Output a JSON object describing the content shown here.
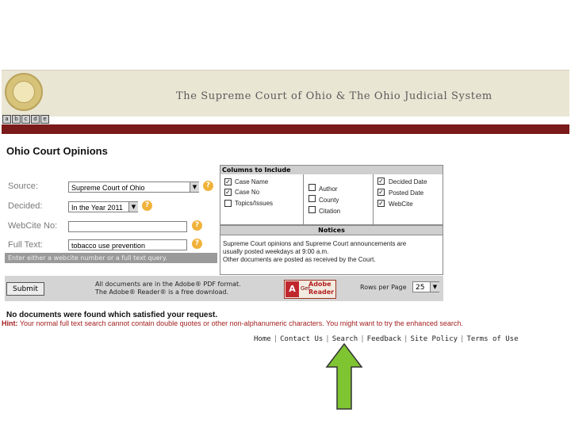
{
  "header": {
    "banner_title": "The Supreme Court of Ohio & The Ohio Judicial System",
    "icon_row": [
      "a",
      "b",
      "c",
      "d",
      "e"
    ]
  },
  "page_title": "Ohio Court Opinions",
  "form": {
    "source_label": "Source:",
    "source_value": "Supreme Court of Ohio",
    "decided_label": "Decided:",
    "decided_value": "In the Year 2011",
    "webcite_label": "WebCite No:",
    "webcite_value": "",
    "fulltext_label": "Full Text:",
    "fulltext_value": "tobacco use prevention",
    "hint_strip": "Enter either a webcite number or a full text query."
  },
  "columns": {
    "header": "Columns to Include",
    "items": [
      {
        "label": "Case Name",
        "checked": true
      },
      {
        "label": "Case No",
        "checked": true
      },
      {
        "label": "Topics/Issues",
        "checked": false
      },
      {
        "label": "Author",
        "checked": false
      },
      {
        "label": "County",
        "checked": false
      },
      {
        "label": "Citation",
        "checked": false
      },
      {
        "label": "Decided Date",
        "checked": true
      },
      {
        "label": "Posted Date",
        "checked": true
      },
      {
        "label": "WebCite",
        "checked": true
      }
    ]
  },
  "notices": {
    "header": "Notices",
    "line1": "Supreme Court opinions and Supreme Court announcements are",
    "line2": "usually posted weekdays at 9:00 a.m.",
    "line3": "Other documents are posted as received by the Court."
  },
  "bottom": {
    "submit_label": "Submit",
    "pdf_line1": "All documents are in the Adobe® PDF format.",
    "pdf_line2": "The Adobe® Reader® is a free download.",
    "adobe_logo": "A",
    "adobe_get": "Get",
    "adobe_word": "Adobe",
    "adobe_reader": "Reader",
    "rows_label": "Rows per Page",
    "rows_value": "25"
  },
  "result": {
    "no_docs": "No documents were found which satisfied your request.",
    "hint_label": "Hint:",
    "hint_text": " Your normal full text search cannot contain double quotes or other non-alphanumeric characters. You might want to try the enhanced search."
  },
  "footer": {
    "links": [
      "Home",
      "Contact Us",
      "Search",
      "Feedback",
      "Site Policy",
      "Terms of Use"
    ]
  },
  "annotation": {
    "arrow_color": "#7fc431"
  }
}
